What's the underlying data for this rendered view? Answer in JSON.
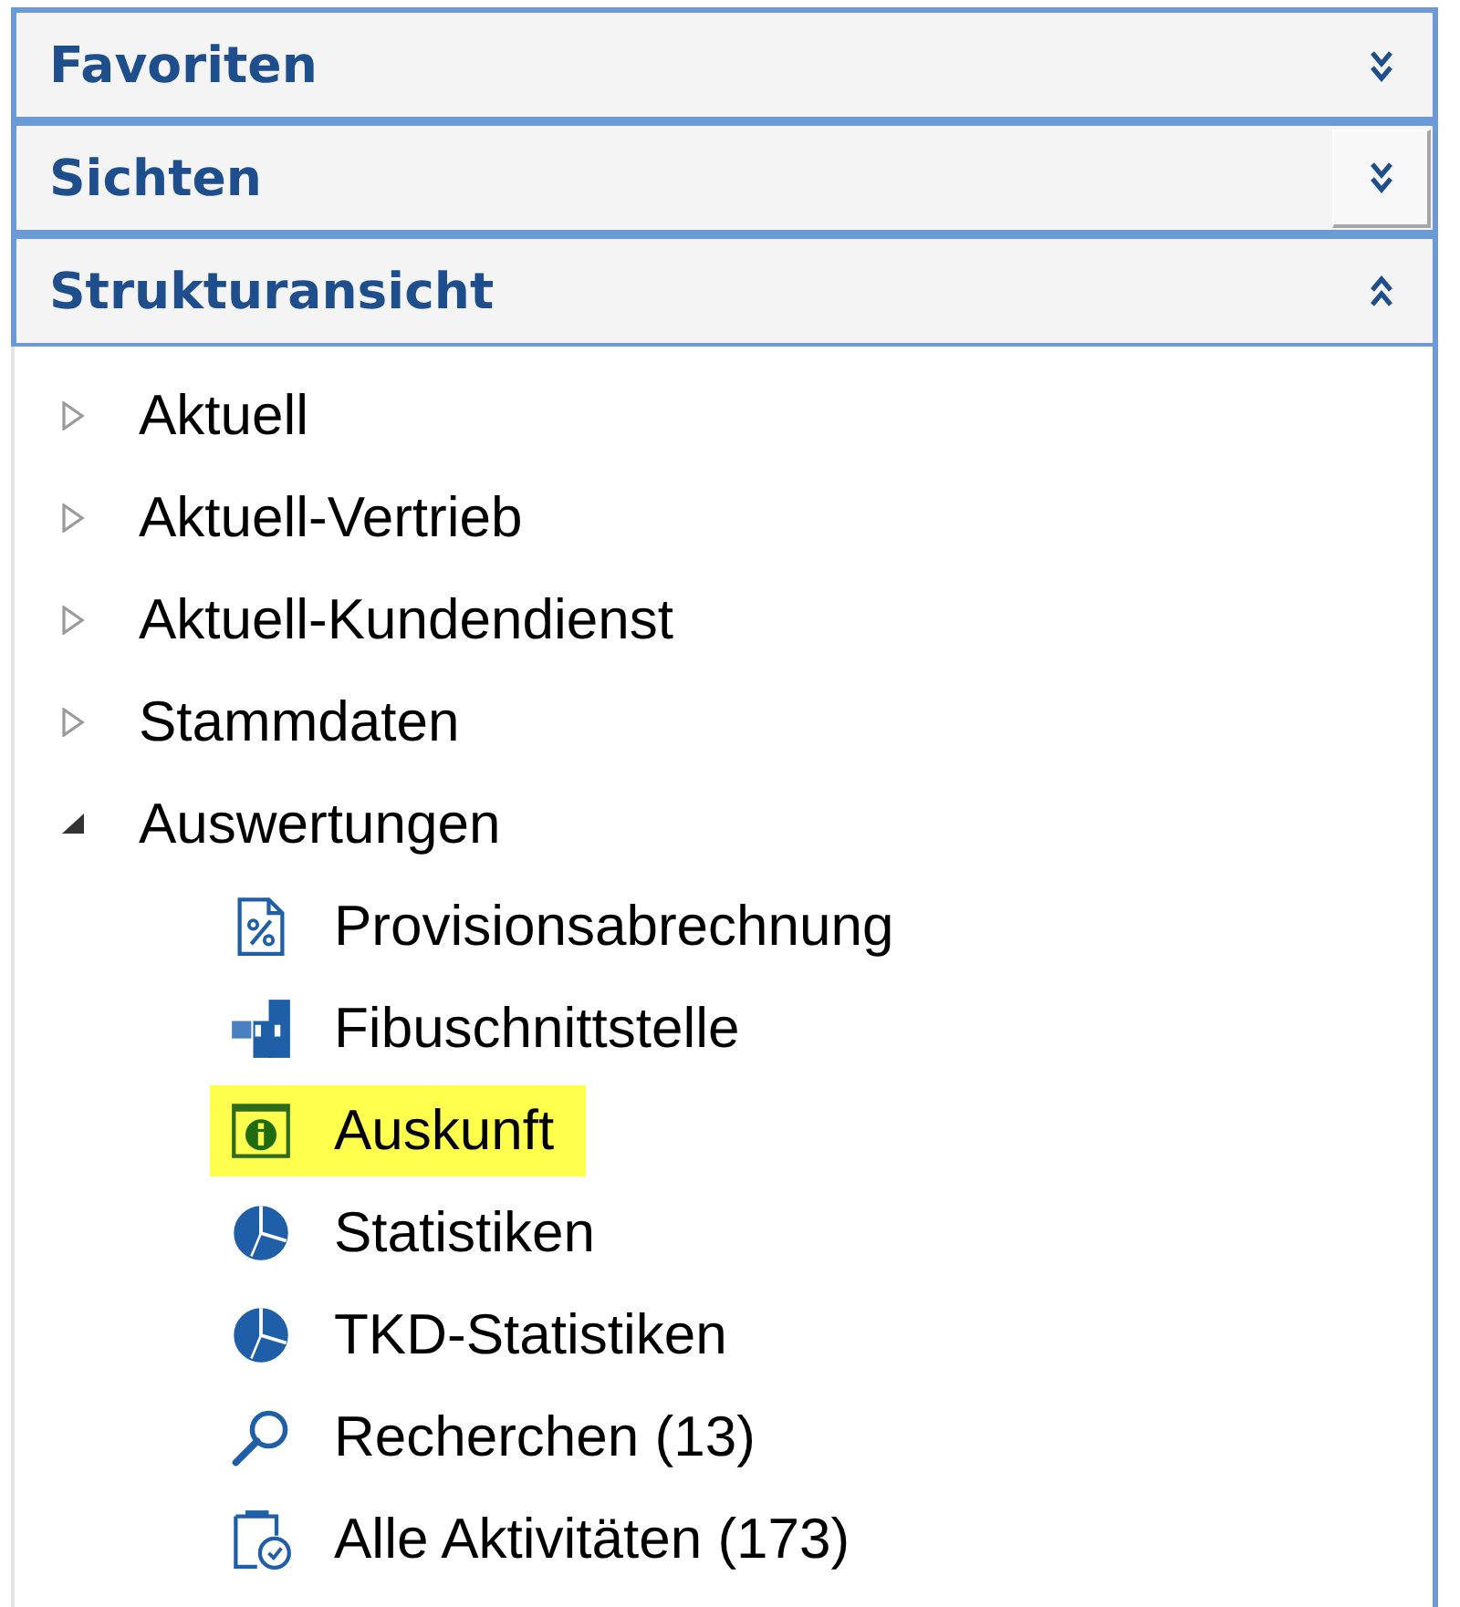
{
  "panel_sections": [
    {
      "title": "Favoriten",
      "expanded": false,
      "hovered": false
    },
    {
      "title": "Sichten",
      "expanded": false,
      "hovered": true
    },
    {
      "title": "Strukturansicht",
      "expanded": true,
      "hovered": false
    }
  ],
  "tree": [
    {
      "label": "Aktuell",
      "expanded": false
    },
    {
      "label": "Aktuell-Vertrieb",
      "expanded": false
    },
    {
      "label": "Aktuell-Kundendienst",
      "expanded": false
    },
    {
      "label": "Stammdaten",
      "expanded": false
    },
    {
      "label": "Auswertungen",
      "expanded": true,
      "children": [
        {
          "label": "Provisionsabrechnung",
          "highlighted": false
        },
        {
          "label": "Fibuschnittstelle",
          "highlighted": false
        },
        {
          "label": "Auskunft",
          "highlighted": true
        },
        {
          "label": "Statistiken",
          "highlighted": false
        },
        {
          "label": "TKD-Statistiken",
          "highlighted": false
        },
        {
          "label": "Recherchen (13)",
          "highlighted": false
        },
        {
          "label": "Alle Aktivitäten (173)",
          "highlighted": false
        }
      ]
    }
  ]
}
